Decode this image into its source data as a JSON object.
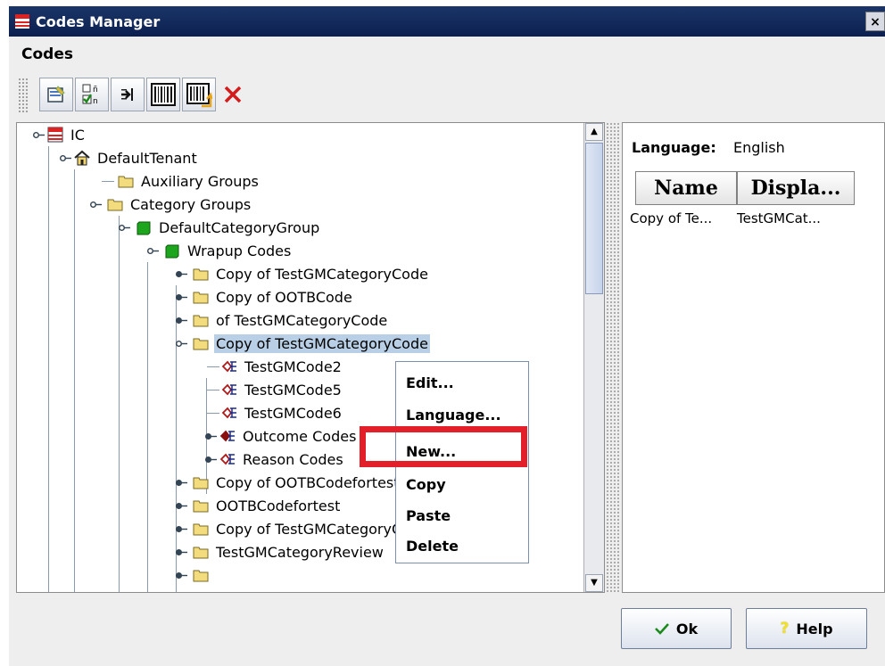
{
  "window": {
    "title": "Codes Manager",
    "close_glyph": "×"
  },
  "panel": {
    "label": "Codes"
  },
  "toolbar": {
    "buttons": [
      {
        "icon": "properties-icon"
      },
      {
        "icon": "check-codes-icon"
      },
      {
        "icon": "import-icon"
      },
      {
        "icon": "barcode-icon"
      },
      {
        "icon": "barcode-export-icon"
      },
      {
        "icon": "delete-icon"
      }
    ]
  },
  "tree": {
    "nodes": [
      {
        "label": "IC"
      },
      {
        "label": "DefaultTenant"
      },
      {
        "label": "Auxiliary Groups"
      },
      {
        "label": "Category Groups"
      },
      {
        "label": "DefaultCategoryGroup"
      },
      {
        "label": "Wrapup Codes"
      },
      {
        "label": "Copy of TestGMCategoryCode"
      },
      {
        "label": "Copy of OOTBCode"
      },
      {
        "label": "of TestGMCategoryCode"
      },
      {
        "label": "Copy of TestGMCategoryCode"
      },
      {
        "label": "TestGMCode2"
      },
      {
        "label": "TestGMCode5"
      },
      {
        "label": "TestGMCode6"
      },
      {
        "label": "Outcome Codes"
      },
      {
        "label": "Reason Codes"
      },
      {
        "label": "Copy of OOTBCodefortest"
      },
      {
        "label": "OOTBCodefortest"
      },
      {
        "label": "Copy of TestGMCategoryCode"
      },
      {
        "label": "TestGMCategoryReview"
      }
    ],
    "selected_index": 9
  },
  "language": {
    "label": "Language:",
    "value": "English"
  },
  "table": {
    "columns": [
      "Name",
      "Displa..."
    ],
    "rows": [
      [
        "Copy of Te...",
        "TestGMCat..."
      ]
    ]
  },
  "context_menu": {
    "items": [
      "Edit...",
      "Language...",
      "New...",
      "Copy",
      "Paste",
      "Delete"
    ],
    "highlighted": "New..."
  },
  "buttons": {
    "ok": "Ok",
    "help": "Help"
  },
  "colors": {
    "highlight_box": "#e3202a",
    "selection": "#b8cfe5",
    "titlebar": "#0b2050"
  }
}
